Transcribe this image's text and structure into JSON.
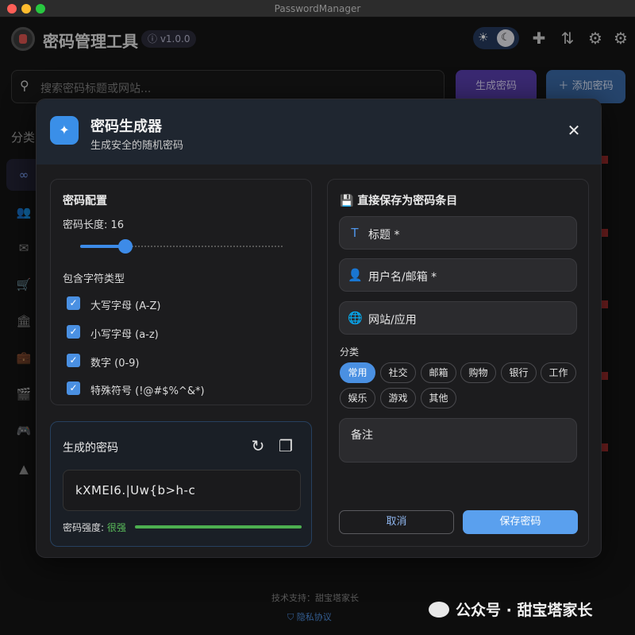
{
  "window": {
    "title": "PasswordManager"
  },
  "header": {
    "app_title": "密码管理工具",
    "version": "ⓘ v1.0.0",
    "icons": [
      "sun-icon",
      "moon-icon",
      "puzzle-icon",
      "sort-arrows-icon",
      "gear-icon",
      "settings-icon"
    ]
  },
  "toolbar": {
    "search_placeholder": "搜索密码标题或网站...",
    "generate_label": "生成密码",
    "add_label": "添加密码"
  },
  "sidebar": {
    "label": "分类",
    "items": [
      {
        "icon": "infinity-icon",
        "active": true
      },
      {
        "icon": "people-icon"
      },
      {
        "icon": "mail-icon"
      },
      {
        "icon": "cart-icon"
      },
      {
        "icon": "bank-icon"
      },
      {
        "icon": "briefcase-icon"
      },
      {
        "icon": "movie-icon"
      },
      {
        "icon": "gamepad-icon"
      },
      {
        "icon": "shapes-icon"
      }
    ]
  },
  "footer": {
    "support": "技术支持：甜宝塔家长",
    "privacy": "隐私协议",
    "watermark": "公众号 · 甜宝塔家长"
  },
  "dialog": {
    "title": "密码生成器",
    "subtitle": "生成安全的随机密码",
    "config": {
      "title": "密码配置",
      "length_label": "密码长度: 16",
      "length_value": 16,
      "types_label": "包含字符类型",
      "options": [
        {
          "label": "大写字母 (A-Z)",
          "checked": true
        },
        {
          "label": "小写字母 (a-z)",
          "checked": true
        },
        {
          "label": "数字 (0-9)",
          "checked": true
        },
        {
          "label": "特殊符号 (!@#$%^&*)",
          "checked": true
        }
      ]
    },
    "output": {
      "title": "生成的密码",
      "password": "kXMEI6.|Uw{b>h-c",
      "strength_label": "密码强度: ",
      "strength_value": "很强",
      "strength_fraction": 1.0
    },
    "save": {
      "title": "直接保存为密码条目",
      "title_field": "标题 *",
      "username_field": "用户名/邮箱 *",
      "website_field": "网站/应用",
      "category_label": "分类",
      "categories": [
        "常用",
        "社交",
        "邮箱",
        "购物",
        "银行",
        "工作",
        "娱乐",
        "游戏",
        "其他"
      ],
      "selected_category": "常用",
      "notes_placeholder": "备注",
      "cancel_label": "取消",
      "save_label": "保存密码"
    }
  },
  "colors": {
    "accent": "#4a90e2",
    "strength": "#4caf50",
    "generate_btn": "#5a3fb0"
  }
}
